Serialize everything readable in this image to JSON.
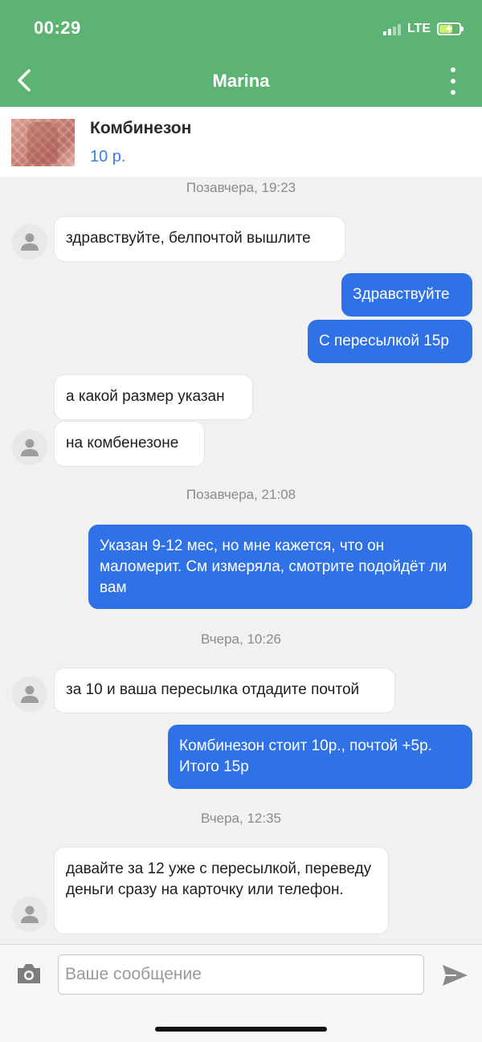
{
  "status_bar": {
    "time": "00:29",
    "network": "LTE"
  },
  "header": {
    "title": "Marina"
  },
  "product": {
    "name": "Комбинезон",
    "price": "10 р."
  },
  "messages": [
    {
      "type": "day",
      "text": "Позавчера, 19:23"
    },
    {
      "type": "in",
      "text": "здравствуйте, белпочтой вышлите"
    },
    {
      "type": "out",
      "text": "Здравствуйте"
    },
    {
      "type": "out",
      "text": "С пересылкой 15р"
    },
    {
      "type": "in",
      "text": "а какой размер указан"
    },
    {
      "type": "in",
      "text": "на комбенезоне"
    },
    {
      "type": "day",
      "text": "Позавчера, 21:08"
    },
    {
      "type": "out",
      "text": "Указан 9-12 мес, но мне кажется, что он маломерит. См измеряла, смотрите подойдёт ли вам"
    },
    {
      "type": "day",
      "text": "Вчера, 10:26"
    },
    {
      "type": "in",
      "text": "за 10 и ваша пересылка отдадите почтой"
    },
    {
      "type": "out",
      "text": "Комбинезон стоит 10р., почтой +5р. Итого 15р"
    },
    {
      "type": "day",
      "text": "Вчера, 12:35"
    },
    {
      "type": "in",
      "text": "давайте за 12 уже с пересылкой, переведу деньги сразу на карточку или телефон."
    }
  ],
  "composer": {
    "placeholder": "Ваше сообщение"
  },
  "colors": {
    "header_bg": "#5db374",
    "outgoing_bubble": "#2f72e8",
    "price": "#3b7be6"
  }
}
